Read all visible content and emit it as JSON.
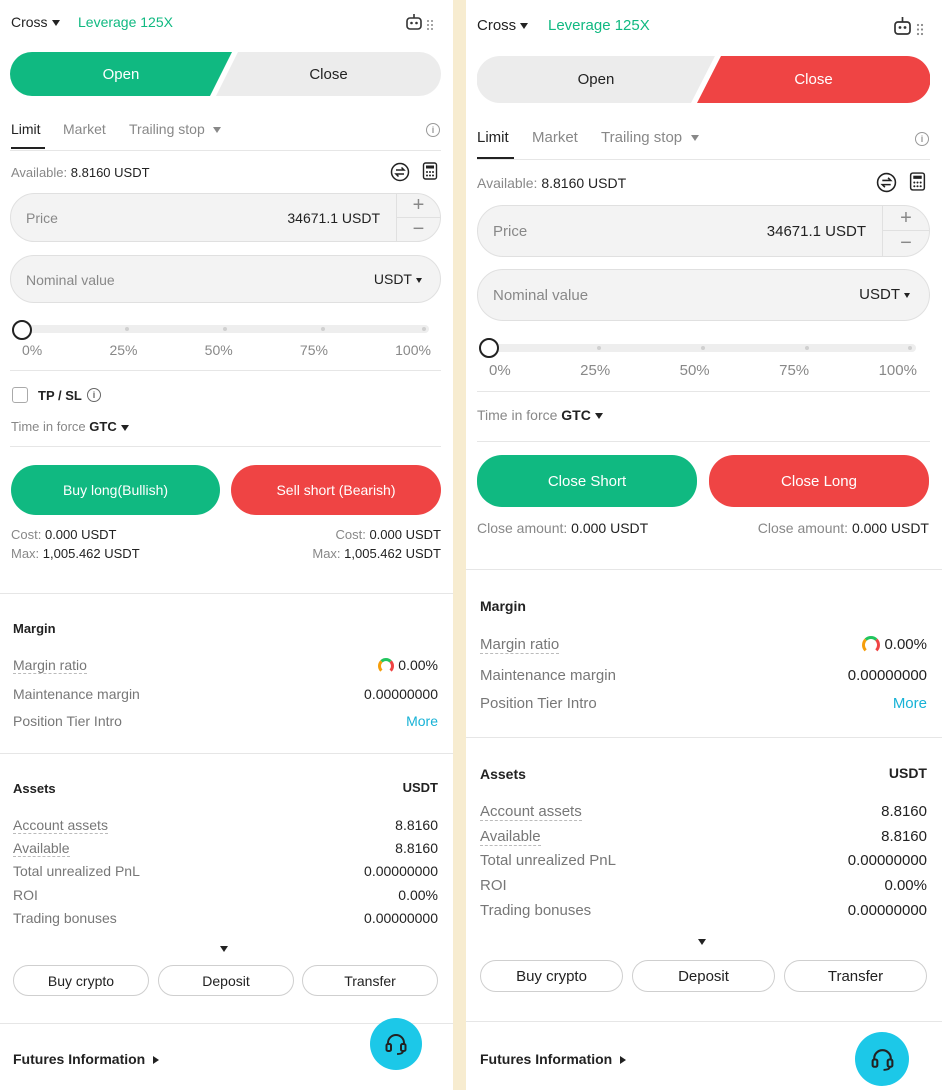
{
  "colors": {
    "green": "#10b981",
    "red": "#ef4444",
    "cyan": "#1cc8e8"
  },
  "left": {
    "mode": "Cross",
    "leverage": "Leverage 125X",
    "toggle": {
      "open": "Open",
      "close": "Close",
      "active": "open"
    },
    "tabs": {
      "limit": "Limit",
      "market": "Market",
      "trailing": "Trailing stop"
    },
    "available_label": "Available:",
    "available_value": "8.8160 USDT",
    "price": {
      "label": "Price",
      "value": "34671.1 USDT",
      "plus": "+",
      "minus": "−"
    },
    "nominal": {
      "label": "Nominal value",
      "unit": "USDT"
    },
    "slider": {
      "ticks": [
        "0%",
        "25%",
        "50%",
        "75%",
        "100%"
      ],
      "value_percent": 0
    },
    "tpsl": "TP / SL",
    "tif_label": "Time in force",
    "tif_value": "GTC",
    "buy": "Buy long(Bullish)",
    "sell": "Sell short (Bearish)",
    "cost_label": "Cost:",
    "cost_value": "0.000 USDT",
    "max_label": "Max:",
    "max_value": "1,005.462 USDT",
    "margin": {
      "title": "Margin",
      "ratio_label": "Margin ratio",
      "ratio_value": "0.00%",
      "maint_label": "Maintenance margin",
      "maint_value": "0.00000000",
      "tier_label": "Position Tier Intro",
      "tier_link": "More"
    },
    "assets": {
      "title": "Assets",
      "currency": "USDT",
      "rows": [
        {
          "k": "Account assets",
          "v": "8.8160"
        },
        {
          "k": "Available",
          "v": "8.8160"
        },
        {
          "k": "Total unrealized PnL",
          "v": "0.00000000"
        },
        {
          "k": "ROI",
          "v": "0.00%"
        },
        {
          "k": "Trading bonuses",
          "v": "0.00000000"
        }
      ]
    },
    "actions": [
      "Buy crypto",
      "Deposit",
      "Transfer"
    ],
    "futures_info": "Futures Information"
  },
  "right": {
    "mode": "Cross",
    "leverage": "Leverage 125X",
    "toggle": {
      "open": "Open",
      "close": "Close",
      "active": "close"
    },
    "tabs": {
      "limit": "Limit",
      "market": "Market",
      "trailing": "Trailing stop"
    },
    "available_label": "Available:",
    "available_value": "8.8160 USDT",
    "price": {
      "label": "Price",
      "value": "34671.1 USDT",
      "plus": "+",
      "minus": "−"
    },
    "nominal": {
      "label": "Nominal value",
      "unit": "USDT"
    },
    "slider": {
      "ticks": [
        "0%",
        "25%",
        "50%",
        "75%",
        "100%"
      ],
      "value_percent": 0
    },
    "tif_label": "Time in force",
    "tif_value": "GTC",
    "close_short": "Close Short",
    "close_long": "Close Long",
    "close_amount_label": "Close amount:",
    "close_amount_value": "0.000 USDT",
    "margin": {
      "title": "Margin",
      "ratio_label": "Margin ratio",
      "ratio_value": "0.00%",
      "maint_label": "Maintenance margin",
      "maint_value": "0.00000000",
      "tier_label": "Position Tier Intro",
      "tier_link": "More"
    },
    "assets": {
      "title": "Assets",
      "currency": "USDT",
      "rows": [
        {
          "k": "Account assets",
          "v": "8.8160"
        },
        {
          "k": "Available",
          "v": "8.8160"
        },
        {
          "k": "Total unrealized PnL",
          "v": "0.00000000"
        },
        {
          "k": "ROI",
          "v": "0.00%"
        },
        {
          "k": "Trading bonuses",
          "v": "0.00000000"
        }
      ]
    },
    "actions": [
      "Buy crypto",
      "Deposit",
      "Transfer"
    ],
    "futures_info": "Futures Information"
  }
}
